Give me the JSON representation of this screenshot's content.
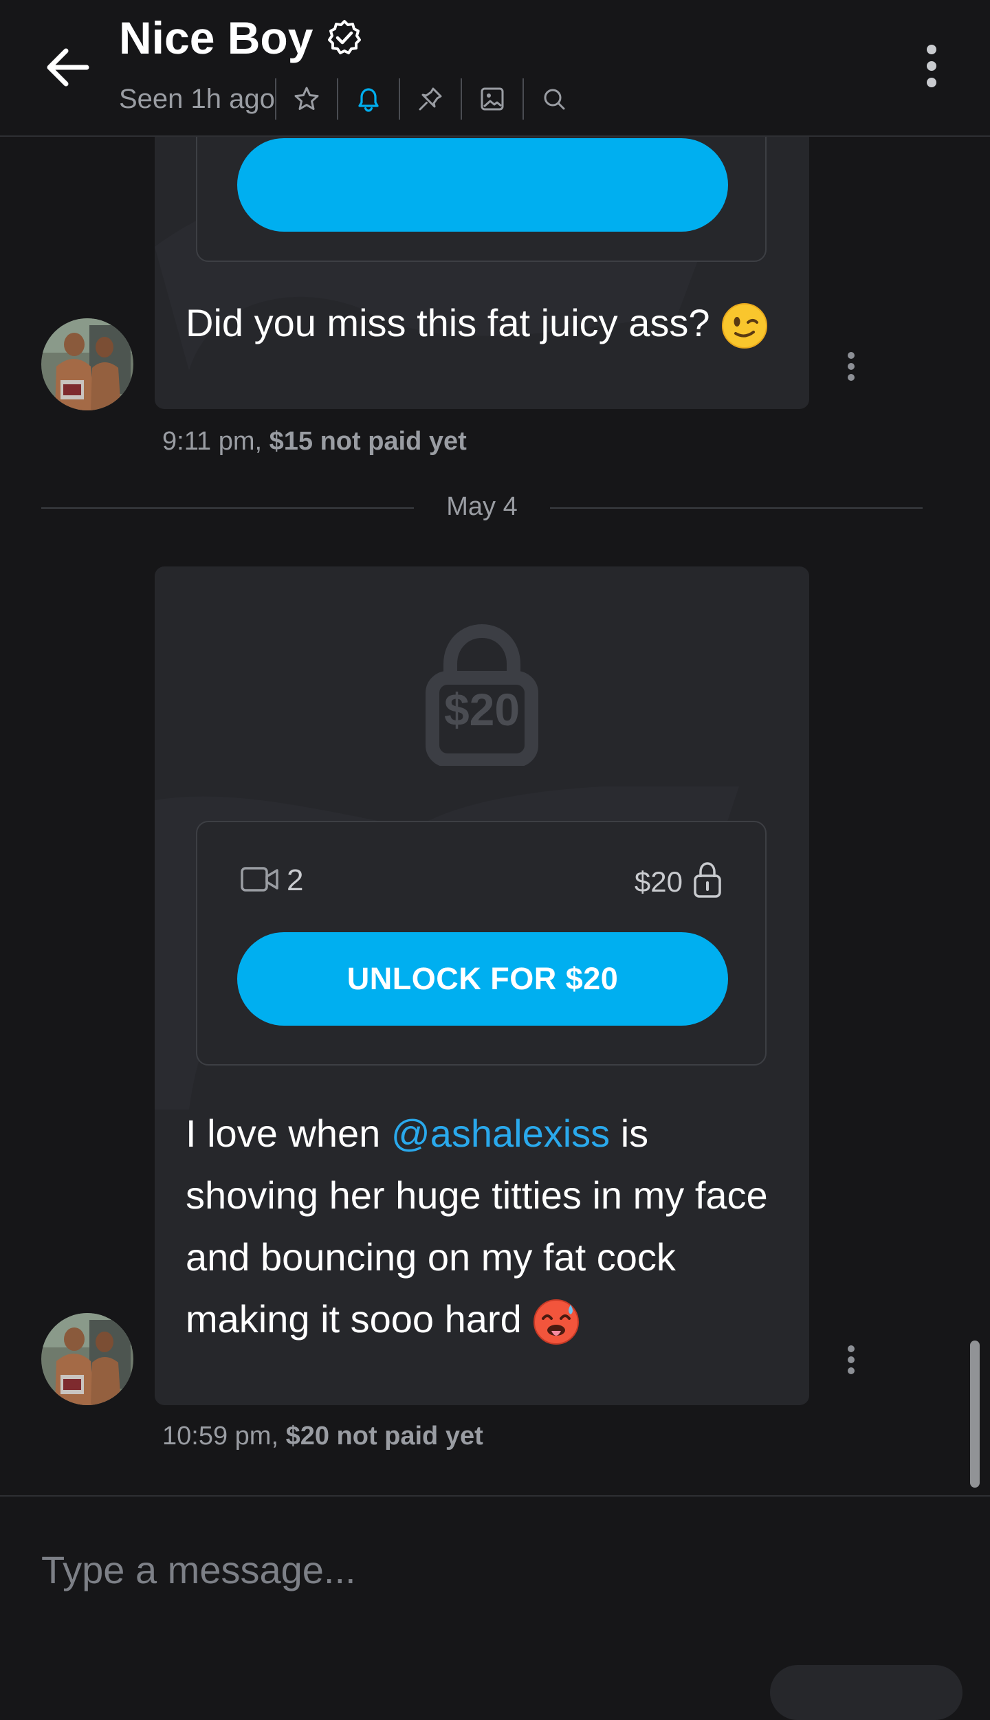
{
  "header": {
    "title": "Nice Boy",
    "seen": "Seen 1h ago",
    "icons": [
      "back-arrow-icon",
      "verified-badge-icon",
      "star-icon",
      "bell-icon",
      "pin-icon",
      "image-icon",
      "search-icon",
      "more-vertical-icon"
    ],
    "accent_color": "#00aff0"
  },
  "messages": [
    {
      "text": "Did you miss this fat juicy ass? ",
      "emoji": "winking-face",
      "time": "9:11 pm,",
      "price_status": "$15 not paid yet"
    },
    {
      "lock_price": "$20",
      "video_count": "2",
      "media_price": "$20",
      "unlock_label": "UNLOCK FOR $20",
      "text_before": "I love when ",
      "mention": "@ashalexiss",
      "text_after": " is shoving her huge titties in my face and bouncing on my fat cock making it sooo hard ",
      "emoji": "hot-face",
      "time": "10:59 pm,",
      "price_status": "$20 not paid yet"
    }
  ],
  "date_separator": "May 4",
  "composer": {
    "placeholder": "Type a message..."
  }
}
